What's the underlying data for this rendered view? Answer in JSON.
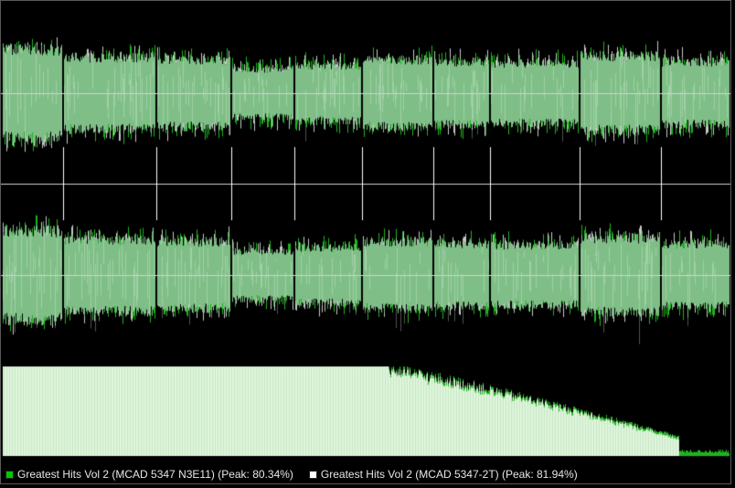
{
  "colors": {
    "background": "#000000",
    "wave_fill": "#7fbf87",
    "wave_edge_a": "#1eb41e",
    "wave_edge_b": "#c8c8c8",
    "centerline": "#d2d2d2",
    "track_marker": "#ffffff",
    "spectrum_fill": "#dff5dc",
    "spectrum_edge": "#1eb41e",
    "legend_text": "#e6e6e6"
  },
  "legend": {
    "entries": [
      {
        "label": "Greatest Hits Vol 2 (MCAD 5347 N3E11) (Peak: 80.34%)",
        "color": "#00c800"
      },
      {
        "label": "Greatest Hits Vol 2 (MCAD 5347-2T) (Peak: 81.94%)",
        "color": "#ffffff"
      }
    ]
  },
  "chart_data": {
    "type": "area",
    "channels": 2,
    "tracks": [
      {
        "index": 1,
        "level": 0.74
      },
      {
        "index": 2,
        "level": 0.6
      },
      {
        "index": 3,
        "level": 0.56
      },
      {
        "index": 4,
        "level": 0.4
      },
      {
        "index": 5,
        "level": 0.46
      },
      {
        "index": 6,
        "level": 0.56
      },
      {
        "index": 7,
        "level": 0.52
      },
      {
        "index": 8,
        "level": 0.5
      },
      {
        "index": 9,
        "level": 0.62
      },
      {
        "index": 10,
        "level": 0.52
      },
      {
        "index": 11,
        "level": 0.46
      }
    ],
    "spectrum": {
      "flat_level": 1.0,
      "rolloff_start": 0.53,
      "rolloff_end": 0.93,
      "floor_level": 0.05
    }
  }
}
